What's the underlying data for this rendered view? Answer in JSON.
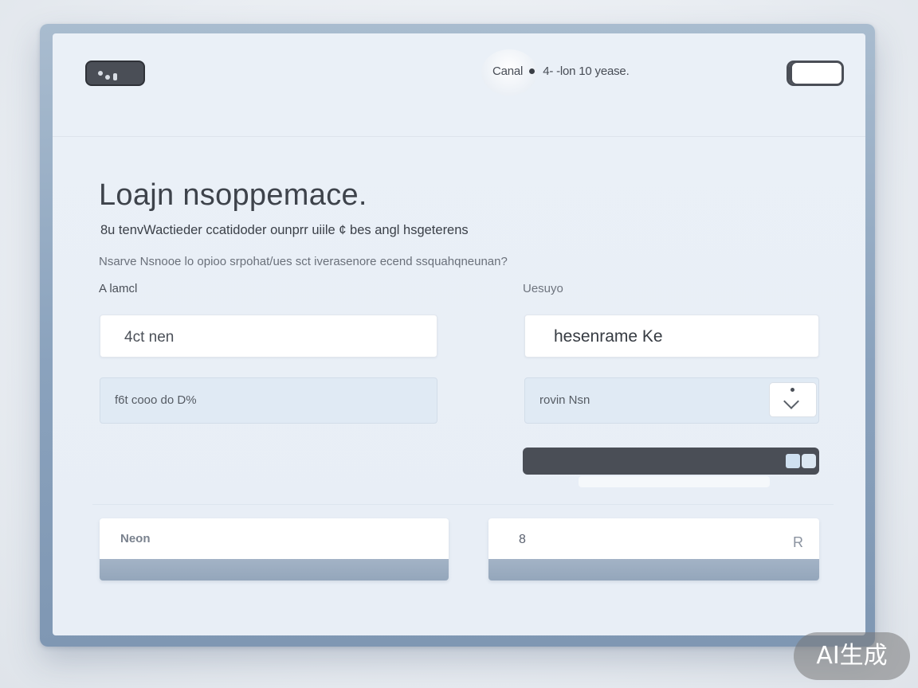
{
  "header": {
    "status_text_a": "Canal",
    "status_text_b": "4-  -lon 10 yease.",
    "logo_icon": "app-logo-icon",
    "toggle_icon": "window-toggle-icon"
  },
  "main": {
    "title": "Loajn nsoppemace.",
    "subtitle": "8u tenvWactieder ccatidoder ounprr uiile ¢ bes angl hsgeterens",
    "hint": "Nsarve Nsnooe lo opioo srpohat/ues sct iverasenore   ecend ssquahqneunan?",
    "label_left": "A lamcl",
    "label_right": "Uesuyo",
    "field_left_top": "4ct nen",
    "field_right_top": "hesenrame Ke",
    "field_left_bottom": "f6t cooo do D%",
    "field_right_bottom": "rovin Nsn"
  },
  "cards": {
    "left_label": "Neon",
    "right_left_icon": "8",
    "right_right_icon": "R"
  },
  "watermark": "AI生成",
  "colors": {
    "frame": "#8aa2bd",
    "window": "#eaf0f7",
    "dark_control": "#4a4e56",
    "soft_field": "#e0eaf4"
  }
}
